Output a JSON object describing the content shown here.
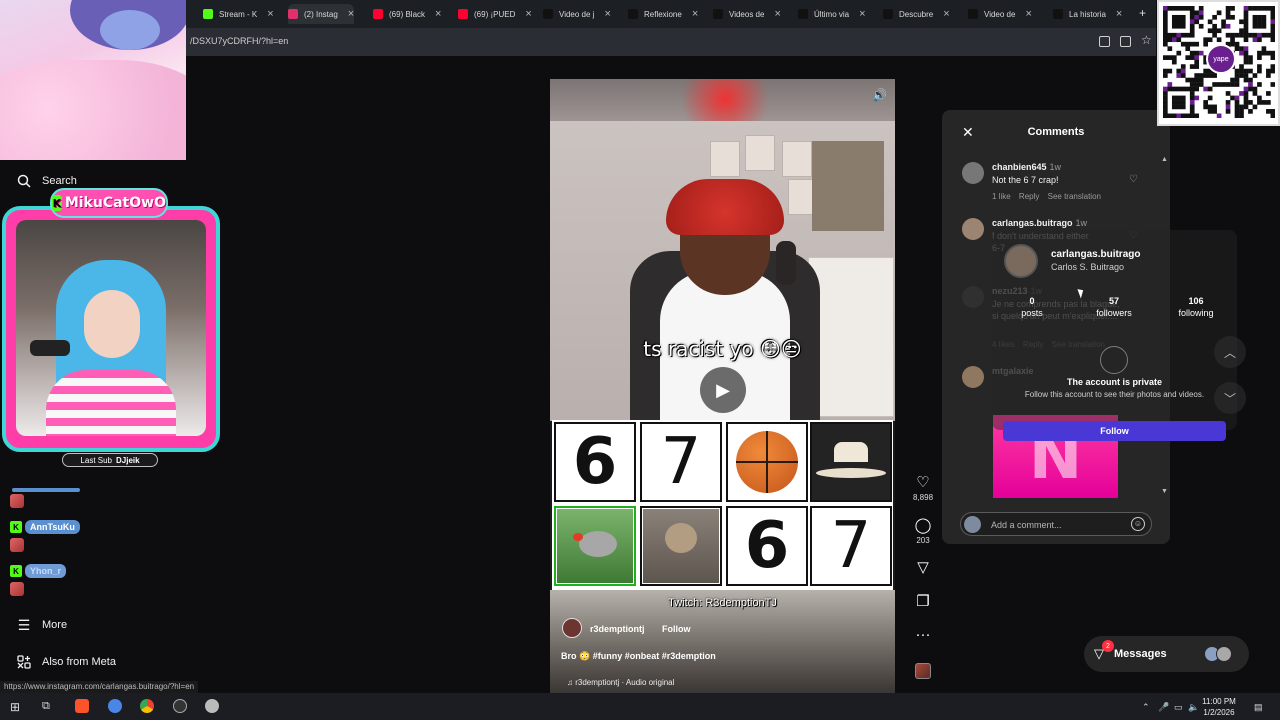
{
  "browser": {
    "tabs": [
      {
        "label": "Stream - K",
        "fav_color": "#53fc18"
      },
      {
        "label": "(2) Instag",
        "fav_color": "#e1306c",
        "active": true
      },
      {
        "label": "(69) Black",
        "fav_color": "#ff0033"
      },
      {
        "label": "(69) ¡PUED",
        "fav_color": "#ff0033"
      },
      {
        "label": "Video de j",
        "fav_color": "#111111"
      },
      {
        "label": "Reflexione",
        "fav_color": "#111111"
      },
      {
        "label": "Videos de",
        "fav_color": "#111111"
      },
      {
        "label": "Último via",
        "fav_color": "#111111"
      },
      {
        "label": "Descubre",
        "fav_color": "#111111"
      },
      {
        "label": "Video de",
        "fav_color": "#111111"
      },
      {
        "label": "La historia",
        "fav_color": "#111111"
      }
    ],
    "new_tab": "+",
    "url": "/DSXU7yCDRFH/?hl=en",
    "status_url": "https://www.instagram.com/carlangas.buitrago/?hl=en"
  },
  "stream": {
    "brand": "MikuCatOwO",
    "brand_k": "K",
    "last_sub_label": "Last Sub",
    "last_sub_name": "DJjeik",
    "chat": [
      {
        "name": "AnnTsuKu"
      },
      {
        "name": "Yhon_r"
      }
    ]
  },
  "nav": {
    "search": "Search",
    "more": "More",
    "also_from_meta": "Also from Meta"
  },
  "reel": {
    "caption": "ts racist yo 😳😒",
    "grid": [
      "6",
      "7",
      "basketball",
      "hat",
      "bird",
      "cat",
      "6",
      "7"
    ],
    "watermark": "Twitch: R3demptionTJ",
    "username": "r3demptiontj",
    "follow": "Follow",
    "description": "Bro 😳 #funny #onbeat #r3demption",
    "audio": "r3demptiontj · Audio original"
  },
  "actions": {
    "likes": "8,898",
    "comments": "203"
  },
  "comments_panel": {
    "title": "Comments",
    "items": [
      {
        "user": "chanbien645",
        "time": "1w",
        "text": "Not the 6 7 crap!",
        "likes": "1 like",
        "reply": "Reply",
        "translate": "See translation"
      },
      {
        "user": "carlangas.buitrago",
        "time": "1w",
        "text": "I don't understand either",
        "text2": "6-7"
      },
      {
        "user": "nezu213",
        "time": "1w",
        "text": "Je ne comprends pas la blague, si quelqu'un peut m'expliquer....",
        "likes": "4 likes",
        "reply": "Reply",
        "translate": "See translation"
      },
      {
        "user": "mtgalaxie",
        "time": ""
      }
    ],
    "add_placeholder": "Add a comment..."
  },
  "hover_card": {
    "username": "carlangas.buitrago",
    "full_name": "Carlos S. Buitrago",
    "posts": "0",
    "posts_label": "posts",
    "followers": "57",
    "followers_label": "followers",
    "following": "106",
    "following_label": "following",
    "private_title": "The account is private",
    "private_sub": "Follow this account to see their photos and videos.",
    "follow": "Follow"
  },
  "messages": {
    "label": "Messages",
    "badge": "2"
  },
  "qr": {
    "logo": "yape"
  },
  "taskbar": {
    "time": "11:00 PM",
    "date": "1/2/2026"
  }
}
